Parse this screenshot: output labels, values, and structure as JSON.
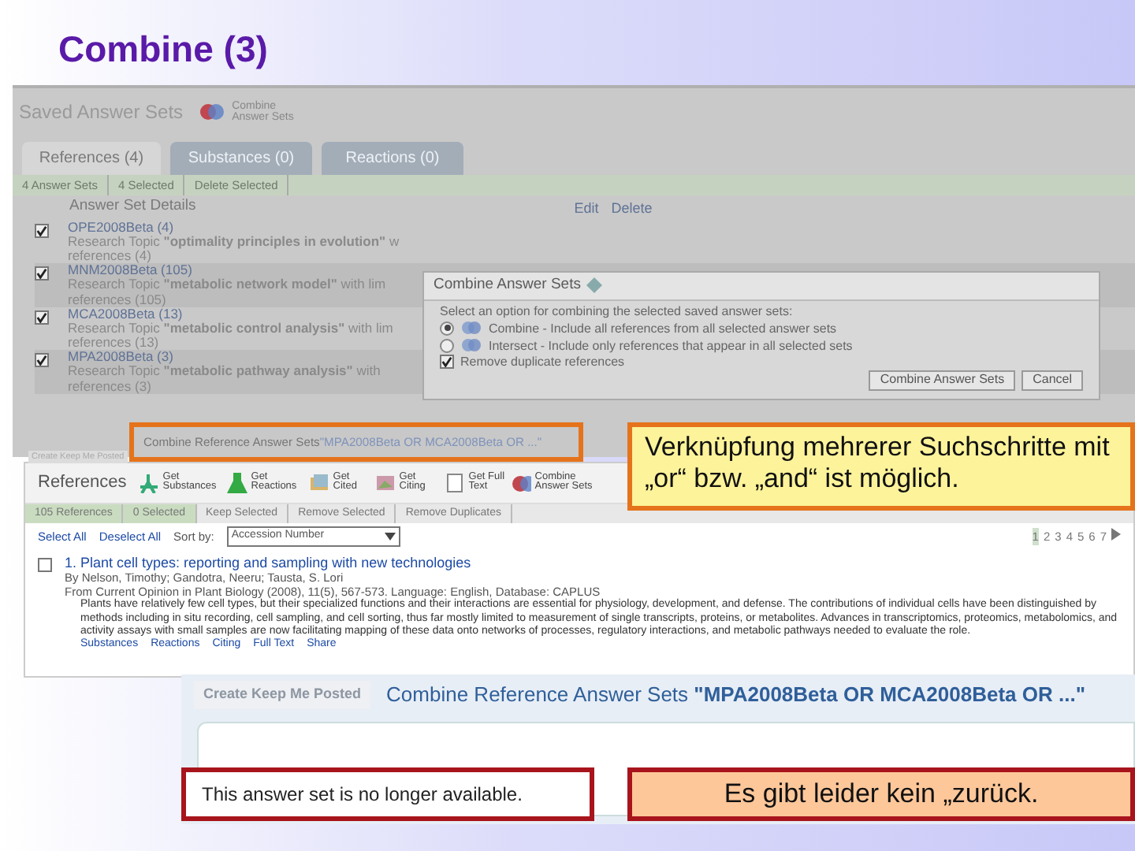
{
  "slide": {
    "title": "Combine (3)"
  },
  "saved_sets": {
    "heading": "Saved Answer Sets",
    "combine_link": "Combine Answer Sets",
    "tabs": [
      {
        "label": "References (4)",
        "selected": true
      },
      {
        "label": "Substances (0)",
        "selected": false
      },
      {
        "label": "Reactions (0)",
        "selected": false
      }
    ],
    "count": "4 Answer Sets",
    "selected_count": "4 Selected",
    "delete_selected": "Delete Selected",
    "section_title": "Answer Set Details",
    "row_actions": [
      "Edit",
      "Delete"
    ],
    "answer_sets": [
      {
        "name": "OPE2008Beta (4)",
        "topic": "Research Topic **\"optimality principles in evolution\"** w",
        "references": "references (4)",
        "checked": true
      },
      {
        "name": "MNM2008Beta (105)",
        "topic": "Research Topic **\"metabolic network model\"** with lim",
        "references": "references (105)",
        "checked": true
      },
      {
        "name": "MCA2008Beta (13)",
        "topic": "Research Topic **\"metabolic control analysis\"** with lim",
        "references": "references (13)",
        "checked": true
      },
      {
        "name": "MPA2008Beta (3)",
        "topic": "Research Topic **\"metabolic pathway analysis\"** with",
        "references": "references (3)",
        "checked": true
      }
    ]
  },
  "dialog": {
    "title": "Combine Answer Sets",
    "prompt": "Select an option for combining the selected saved answer sets:",
    "options": [
      {
        "label": "Combine - Include all references from all selected answer sets",
        "selected": true
      },
      {
        "label": "Intersect - Include only references that appear in all selected sets",
        "selected": false
      }
    ],
    "remove_duplicates": {
      "label": "Remove duplicate references",
      "checked": true
    },
    "buttons": [
      "Combine Answer Sets",
      "Cancel"
    ]
  },
  "result_strip": {
    "button": "Create Keep Me Posted",
    "label": "Combine Reference Answer Sets",
    "query": "\"MPA2008Beta OR MCA2008Beta OR ...\""
  },
  "references": {
    "heading": "References",
    "tools": [
      "Get Substances",
      "Get Reactions",
      "Get Cited",
      "Get Citing",
      "Get Full Text",
      "Combine Answer Sets"
    ],
    "count": "105 References",
    "selected_count": "0 Selected",
    "actions": [
      "Keep Selected",
      "Remove Selected",
      "Remove Duplicates"
    ],
    "select_all": "Select All",
    "deselect_all": "Deselect All",
    "sort_label": "Sort by:",
    "sort_value": "Accession Number",
    "pages": [
      {
        "label": "1",
        "selected": true
      },
      {
        "label": "2",
        "selected": false
      },
      {
        "label": "3",
        "selected": false
      },
      {
        "label": "4",
        "selected": false
      },
      {
        "label": "5",
        "selected": false
      },
      {
        "label": "6",
        "selected": false
      },
      {
        "label": "7",
        "selected": false
      }
    ],
    "item": {
      "title": "1. Plant cell types: reporting and sampling with new technologies",
      "checked": false,
      "authors": "By Nelson, Timothy; Gandotra, Neeru; Tausta, S. Lori",
      "source": "From Current Opinion in Plant Biology (2008), 11(5), 567-573. Language: English, Database: CAPLUS",
      "abstract": "Plants have relatively few cell types, but their specialized functions and their interactions are essential for physiology, development, and defense. The contributions of individual cells have been distinguished by methods including in situ recording, cell sampling, and cell sorting, thus far mostly limited to measurement of single transcripts, proteins, or metabolites. Advances in transcriptomics, proteomics, metabolomics, and activity assays with small samples are now facilitating mapping of these data onto networks of processes, regulatory interactions, and metabolic pathways needed to evaluate the role.",
      "links": [
        "Substances",
        "Reactions",
        "Citing",
        "Full Text",
        "Share"
      ]
    }
  },
  "callout_top": {
    "text": "Verknüpfung mehrerer Suchschritte mit „or“ bzw. „and“ ist möglich."
  },
  "unavailable": {
    "button": "Create Keep Me Posted",
    "label": "Combine Reference Answer Sets",
    "query": "\"MPA2008Beta OR MCA2008Beta OR ...\"",
    "message": "This answer set is no longer available."
  },
  "callout_bottom": {
    "text": "Es gibt leider kein „zurück."
  }
}
